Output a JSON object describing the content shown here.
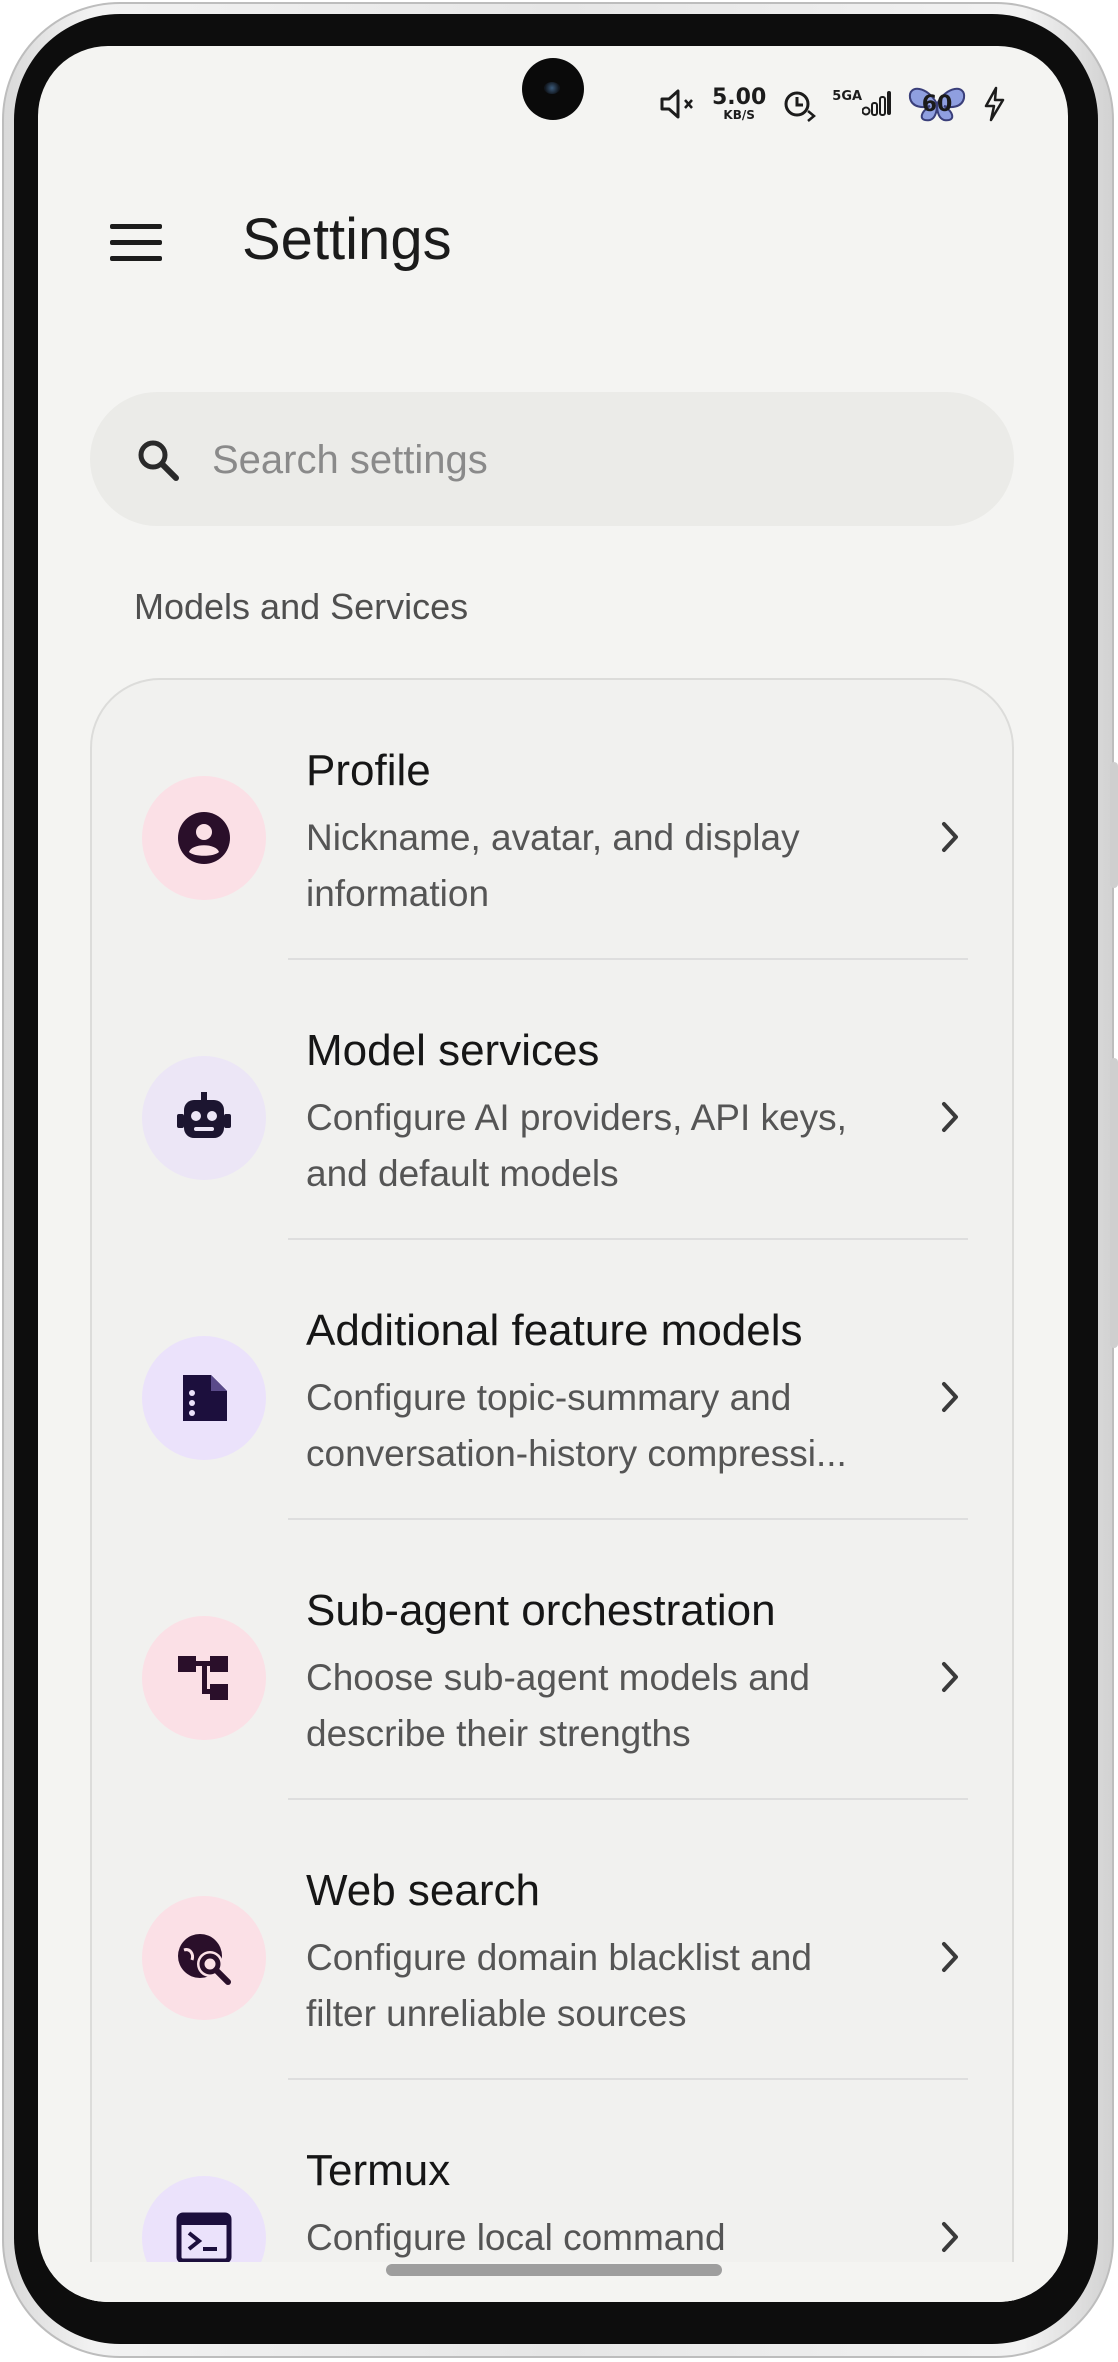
{
  "status_bar": {
    "net_speed_value": "5.00",
    "net_speed_unit": "KB/S",
    "signal_label": "5GA",
    "battery_level": "60"
  },
  "header": {
    "title": "Settings"
  },
  "search": {
    "placeholder": "Search settings"
  },
  "section": {
    "title": "Models and Services"
  },
  "settings": [
    {
      "icon": "account-circle-icon",
      "icon_bg": "#fbe0e6",
      "title": "Profile",
      "desc_line1": "Nickname, avatar, and display",
      "desc_line2": "information"
    },
    {
      "icon": "robot-icon",
      "icon_bg": "#ece6f6",
      "title": "Model services",
      "desc_line1": "Configure AI providers, API keys,",
      "desc_line2": "and default models"
    },
    {
      "icon": "document-icon",
      "icon_bg": "#ebe2fb",
      "title": "Additional feature models",
      "desc_line1": "Configure topic-summary and",
      "desc_line2": "conversation-history compressi..."
    },
    {
      "icon": "hierarchy-icon",
      "icon_bg": "#fbe0e6",
      "title": "Sub-agent orchestration",
      "desc_line1": "Choose sub-agent models and",
      "desc_line2": "describe their strengths"
    },
    {
      "icon": "web-search-icon",
      "icon_bg": "#fbe0e6",
      "title": "Web search",
      "desc_line1": "Configure domain blacklist and",
      "desc_line2": "filter unreliable sources"
    },
    {
      "icon": "terminal-icon",
      "icon_bg": "#ebe2fb",
      "title": "Termux",
      "desc_line1": "Configure local command",
      "desc_line2": ""
    }
  ],
  "colors": {
    "icon_dark": "#2a0f2a",
    "icon_purple_dark": "#1c0f3d"
  }
}
